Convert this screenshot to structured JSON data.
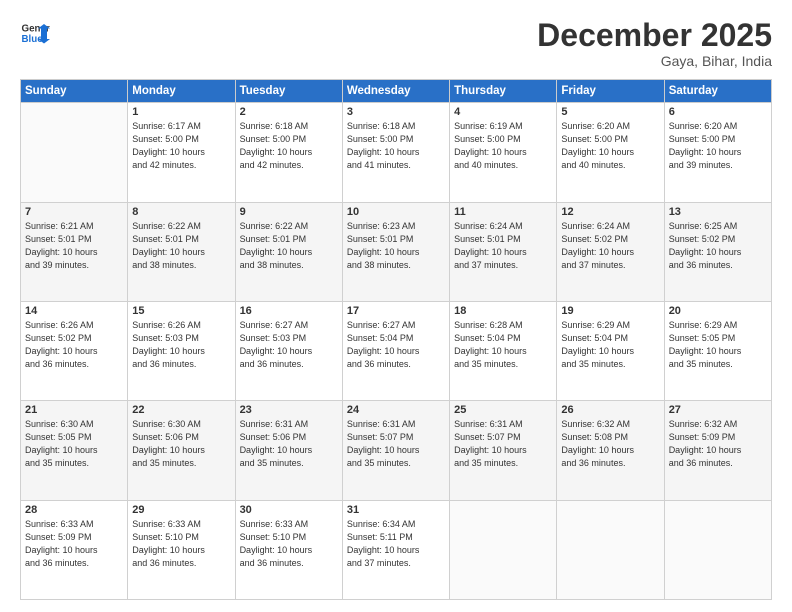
{
  "header": {
    "logo_line1": "General",
    "logo_line2": "Blue",
    "month_title": "December 2025",
    "location": "Gaya, Bihar, India"
  },
  "calendar": {
    "days_of_week": [
      "Sunday",
      "Monday",
      "Tuesday",
      "Wednesday",
      "Thursday",
      "Friday",
      "Saturday"
    ],
    "weeks": [
      {
        "shaded": false,
        "days": [
          {
            "number": "",
            "info": ""
          },
          {
            "number": "1",
            "info": "Sunrise: 6:17 AM\nSunset: 5:00 PM\nDaylight: 10 hours\nand 42 minutes."
          },
          {
            "number": "2",
            "info": "Sunrise: 6:18 AM\nSunset: 5:00 PM\nDaylight: 10 hours\nand 42 minutes."
          },
          {
            "number": "3",
            "info": "Sunrise: 6:18 AM\nSunset: 5:00 PM\nDaylight: 10 hours\nand 41 minutes."
          },
          {
            "number": "4",
            "info": "Sunrise: 6:19 AM\nSunset: 5:00 PM\nDaylight: 10 hours\nand 40 minutes."
          },
          {
            "number": "5",
            "info": "Sunrise: 6:20 AM\nSunset: 5:00 PM\nDaylight: 10 hours\nand 40 minutes."
          },
          {
            "number": "6",
            "info": "Sunrise: 6:20 AM\nSunset: 5:00 PM\nDaylight: 10 hours\nand 39 minutes."
          }
        ]
      },
      {
        "shaded": true,
        "days": [
          {
            "number": "7",
            "info": "Sunrise: 6:21 AM\nSunset: 5:01 PM\nDaylight: 10 hours\nand 39 minutes."
          },
          {
            "number": "8",
            "info": "Sunrise: 6:22 AM\nSunset: 5:01 PM\nDaylight: 10 hours\nand 38 minutes."
          },
          {
            "number": "9",
            "info": "Sunrise: 6:22 AM\nSunset: 5:01 PM\nDaylight: 10 hours\nand 38 minutes."
          },
          {
            "number": "10",
            "info": "Sunrise: 6:23 AM\nSunset: 5:01 PM\nDaylight: 10 hours\nand 38 minutes."
          },
          {
            "number": "11",
            "info": "Sunrise: 6:24 AM\nSunset: 5:01 PM\nDaylight: 10 hours\nand 37 minutes."
          },
          {
            "number": "12",
            "info": "Sunrise: 6:24 AM\nSunset: 5:02 PM\nDaylight: 10 hours\nand 37 minutes."
          },
          {
            "number": "13",
            "info": "Sunrise: 6:25 AM\nSunset: 5:02 PM\nDaylight: 10 hours\nand 36 minutes."
          }
        ]
      },
      {
        "shaded": false,
        "days": [
          {
            "number": "14",
            "info": "Sunrise: 6:26 AM\nSunset: 5:02 PM\nDaylight: 10 hours\nand 36 minutes."
          },
          {
            "number": "15",
            "info": "Sunrise: 6:26 AM\nSunset: 5:03 PM\nDaylight: 10 hours\nand 36 minutes."
          },
          {
            "number": "16",
            "info": "Sunrise: 6:27 AM\nSunset: 5:03 PM\nDaylight: 10 hours\nand 36 minutes."
          },
          {
            "number": "17",
            "info": "Sunrise: 6:27 AM\nSunset: 5:04 PM\nDaylight: 10 hours\nand 36 minutes."
          },
          {
            "number": "18",
            "info": "Sunrise: 6:28 AM\nSunset: 5:04 PM\nDaylight: 10 hours\nand 35 minutes."
          },
          {
            "number": "19",
            "info": "Sunrise: 6:29 AM\nSunset: 5:04 PM\nDaylight: 10 hours\nand 35 minutes."
          },
          {
            "number": "20",
            "info": "Sunrise: 6:29 AM\nSunset: 5:05 PM\nDaylight: 10 hours\nand 35 minutes."
          }
        ]
      },
      {
        "shaded": true,
        "days": [
          {
            "number": "21",
            "info": "Sunrise: 6:30 AM\nSunset: 5:05 PM\nDaylight: 10 hours\nand 35 minutes."
          },
          {
            "number": "22",
            "info": "Sunrise: 6:30 AM\nSunset: 5:06 PM\nDaylight: 10 hours\nand 35 minutes."
          },
          {
            "number": "23",
            "info": "Sunrise: 6:31 AM\nSunset: 5:06 PM\nDaylight: 10 hours\nand 35 minutes."
          },
          {
            "number": "24",
            "info": "Sunrise: 6:31 AM\nSunset: 5:07 PM\nDaylight: 10 hours\nand 35 minutes."
          },
          {
            "number": "25",
            "info": "Sunrise: 6:31 AM\nSunset: 5:07 PM\nDaylight: 10 hours\nand 35 minutes."
          },
          {
            "number": "26",
            "info": "Sunrise: 6:32 AM\nSunset: 5:08 PM\nDaylight: 10 hours\nand 36 minutes."
          },
          {
            "number": "27",
            "info": "Sunrise: 6:32 AM\nSunset: 5:09 PM\nDaylight: 10 hours\nand 36 minutes."
          }
        ]
      },
      {
        "shaded": false,
        "days": [
          {
            "number": "28",
            "info": "Sunrise: 6:33 AM\nSunset: 5:09 PM\nDaylight: 10 hours\nand 36 minutes."
          },
          {
            "number": "29",
            "info": "Sunrise: 6:33 AM\nSunset: 5:10 PM\nDaylight: 10 hours\nand 36 minutes."
          },
          {
            "number": "30",
            "info": "Sunrise: 6:33 AM\nSunset: 5:10 PM\nDaylight: 10 hours\nand 36 minutes."
          },
          {
            "number": "31",
            "info": "Sunrise: 6:34 AM\nSunset: 5:11 PM\nDaylight: 10 hours\nand 37 minutes."
          },
          {
            "number": "",
            "info": ""
          },
          {
            "number": "",
            "info": ""
          },
          {
            "number": "",
            "info": ""
          }
        ]
      }
    ]
  }
}
